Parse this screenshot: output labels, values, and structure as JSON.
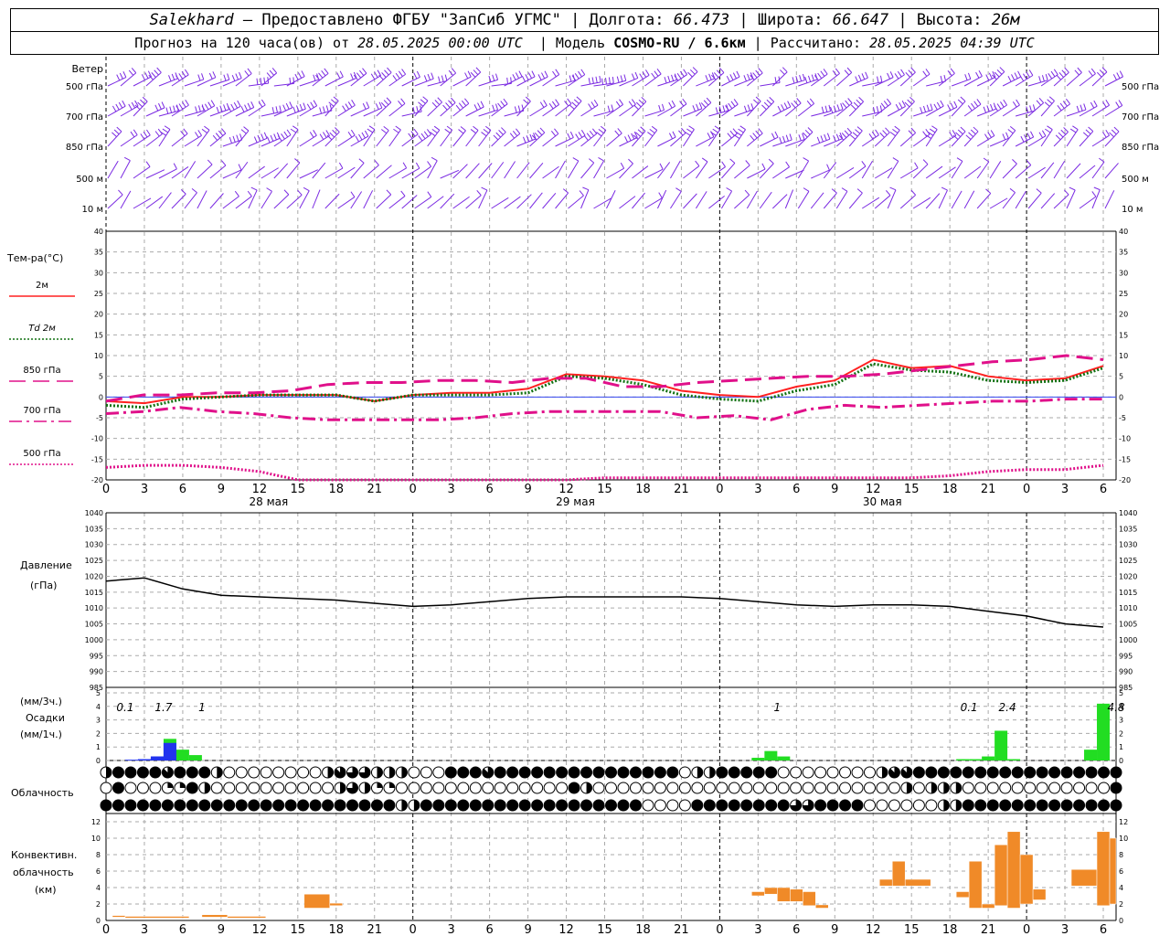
{
  "header": {
    "station": "Salekhard",
    "provided": "– Предоставлено ФГБУ \"ЗапСиб УГМС\" | Долгота:",
    "lon": "66.473",
    "lat_label": "| Широта:",
    "lat": "66.647",
    "alt_label": "| Высота:",
    "alt": "26м",
    "forecast_prefix": "Прогноз на 120 часа(ов) от",
    "forecast_start": "28.05.2025 00:00 UTC",
    "model_label": "| Модель",
    "model": "COSMO-RU / 6.6км",
    "calc_label": "| Рассчитано:",
    "calc_time": "28.05.2025 04:39 UTC"
  },
  "wind_panel": {
    "title": "Ветер",
    "levels": [
      "500 гПа",
      "700 гПа",
      "850 гПа",
      "500 м",
      "10  м"
    ],
    "color": "#7b2be2"
  },
  "chart_data": [
    {
      "type": "line",
      "name": "temperature",
      "title": "Тем-ра(°C)",
      "ylim": [
        -20,
        40
      ],
      "yticks": [
        -20,
        -15,
        -10,
        -5,
        0,
        5,
        10,
        15,
        20,
        25,
        30,
        35,
        40
      ],
      "x_hours": [
        0,
        3,
        6,
        9,
        12,
        15,
        18,
        21,
        24,
        27,
        30,
        33,
        36,
        39,
        42,
        45,
        48,
        51,
        54,
        57,
        60,
        63,
        66,
        69,
        72,
        75,
        78
      ],
      "x_tick_labels": [
        "0",
        "3",
        "6",
        "9",
        "12",
        "15",
        "18",
        "21",
        "0",
        "3",
        "6",
        "9",
        "12",
        "15",
        "18",
        "21",
        "0",
        "3",
        "6",
        "9",
        "12",
        "15",
        "18",
        "21",
        "0",
        "3",
        "6"
      ],
      "day_labels": [
        {
          "hour": 12,
          "text": "28 мая"
        },
        {
          "hour": 36,
          "text": "29 мая"
        },
        {
          "hour": 60,
          "text": "30 мая"
        }
      ],
      "series": [
        {
          "name": "2м",
          "color": "#ff2020",
          "style": "solid",
          "values": [
            -1,
            -1.5,
            0,
            0,
            0.5,
            0.5,
            0.5,
            -1,
            0.5,
            1,
            1,
            2,
            5.5,
            5,
            4,
            1.5,
            0.5,
            0,
            2.5,
            4,
            9,
            7,
            7.5,
            5,
            4,
            4.5,
            7.5
          ]
        },
        {
          "name": "Td 2м",
          "color": "#107010",
          "style": "dotted",
          "values": [
            -2,
            -2.5,
            -0.5,
            0,
            0.5,
            0.5,
            0.5,
            -1,
            0.5,
            0.5,
            0.5,
            1,
            5,
            4.5,
            3,
            0.5,
            -0.5,
            -1,
            1.5,
            3,
            8,
            6.5,
            6,
            4,
            3.5,
            4,
            7
          ]
        },
        {
          "name": "850 гПа",
          "color": "#e0108a",
          "style": "longdash",
          "values": [
            -1,
            0.5,
            0.5,
            1,
            1,
            1.5,
            3,
            3.5,
            3.5,
            4,
            4,
            3.5,
            4.5,
            4.5,
            2.5,
            2.5,
            3.5,
            4,
            4.5,
            5,
            5,
            5.5,
            6.5,
            7.5,
            8.5,
            9,
            10,
            9
          ]
        },
        {
          "name": "700 гПа",
          "color": "#e0108a",
          "style": "dashdot",
          "values": [
            -4,
            -3.5,
            -2.5,
            -3.5,
            -4,
            -5,
            -5.5,
            -5.5,
            -5.5,
            -5.5,
            -5,
            -4,
            -3.5,
            -3.5,
            -3.5,
            -3.5,
            -5,
            -4.5,
            -5.5,
            -3,
            -2,
            -2.5,
            -2,
            -1.5,
            -1,
            -1,
            -0.5,
            -0.5
          ]
        },
        {
          "name": "500 гПа",
          "color": "#e0108a",
          "style": "dotted",
          "values": [
            -17,
            -16.5,
            -16.5,
            -17,
            -18,
            -20,
            -21,
            -21,
            -21,
            -21,
            -21,
            -21,
            -20,
            -19.5,
            -19.5,
            -19.5,
            -19.5,
            -19.5,
            -19.5,
            -19.5,
            -19.5,
            -19.5,
            -19,
            -18,
            -17.5,
            -17.5,
            -16.5
          ]
        }
      ]
    },
    {
      "type": "line",
      "name": "pressure",
      "title": "Давление",
      "unit": "(гПа)",
      "ylim": [
        985,
        1040
      ],
      "yticks": [
        985,
        990,
        995,
        1000,
        1005,
        1010,
        1015,
        1020,
        1025,
        1030,
        1035,
        1040
      ],
      "series": [
        {
          "name": "pressure",
          "color": "#000000",
          "values": [
            1018.5,
            1019.5,
            1016,
            1014,
            1013.5,
            1013,
            1012.5,
            1011.5,
            1010.5,
            1011,
            1012,
            1013,
            1013.5,
            1013.5,
            1013.5,
            1013.5,
            1013,
            1012,
            1011,
            1010.5,
            1011,
            1011,
            1010.5,
            1009,
            1007.5,
            1005,
            1004
          ]
        }
      ]
    },
    {
      "type": "bar",
      "name": "precipitation",
      "title": "Осадки",
      "unit_3h": "(мм/3ч.)",
      "unit_1h": "(мм/1ч.)",
      "ylim": [
        0,
        5
      ],
      "yticks": [
        0,
        1,
        2,
        3,
        4,
        5
      ],
      "annotations": [
        {
          "hour": 1.5,
          "text": "0.1"
        },
        {
          "hour": 4.5,
          "text": "1.7"
        },
        {
          "hour": 7.5,
          "text": "1"
        },
        {
          "hour": 52.5,
          "text": "1"
        },
        {
          "hour": 67.5,
          "text": "0.1"
        },
        {
          "hour": 70.5,
          "text": "2.4"
        },
        {
          "hour": 79,
          "text": "4.8"
        }
      ],
      "bars": [
        {
          "hour": 2,
          "value": 0.05,
          "kind": "snow"
        },
        {
          "hour": 3,
          "value": 0.1,
          "kind": "snow"
        },
        {
          "hour": 4,
          "value": 0.3,
          "kind": "snow"
        },
        {
          "hour": 5,
          "value": 1.3,
          "kind": "snow"
        },
        {
          "hour": 5,
          "value": 1.6,
          "kind": "rain"
        },
        {
          "hour": 6,
          "value": 0.8,
          "kind": "rain"
        },
        {
          "hour": 7,
          "value": 0.4,
          "kind": "rain"
        },
        {
          "hour": 51,
          "value": 0.2,
          "kind": "rain"
        },
        {
          "hour": 52,
          "value": 0.7,
          "kind": "rain"
        },
        {
          "hour": 53,
          "value": 0.3,
          "kind": "rain"
        },
        {
          "hour": 67,
          "value": 0.1,
          "kind": "rain"
        },
        {
          "hour": 68,
          "value": 0.1,
          "kind": "rain"
        },
        {
          "hour": 69,
          "value": 0.3,
          "kind": "rain"
        },
        {
          "hour": 70,
          "value": 2.2,
          "kind": "rain"
        },
        {
          "hour": 71,
          "value": 0.1,
          "kind": "rain"
        },
        {
          "hour": 77,
          "value": 0.8,
          "kind": "rain"
        },
        {
          "hour": 78,
          "value": 4.2,
          "kind": "rain"
        }
      ],
      "colors": {
        "rain": "#22dd22",
        "snow": "#2233ee"
      }
    },
    {
      "type": "bar",
      "name": "convective_cloud",
      "title": "Конвективн.",
      "title2": "облачность",
      "unit": "(км)",
      "ylim": [
        0,
        13
      ],
      "yticks": [
        0,
        2,
        4,
        6,
        8,
        10,
        12
      ],
      "bars": [
        {
          "x0": 0.5,
          "x1": 1.5,
          "base": 0.4,
          "top": 0.6
        },
        {
          "x0": 1.5,
          "x1": 6.5,
          "base": 0.3,
          "top": 0.5
        },
        {
          "x0": 7.5,
          "x1": 9.5,
          "base": 0.4,
          "top": 0.7
        },
        {
          "x0": 9.5,
          "x1": 12.5,
          "base": 0.3,
          "top": 0.5
        },
        {
          "x0": 15.5,
          "x1": 17.5,
          "base": 1.5,
          "top": 3.2
        },
        {
          "x0": 17.5,
          "x1": 18.5,
          "base": 1.8,
          "top": 2.1
        },
        {
          "x0": 50.5,
          "x1": 51.5,
          "base": 3.0,
          "top": 3.5
        },
        {
          "x0": 51.5,
          "x1": 52.5,
          "base": 3.2,
          "top": 4.0
        },
        {
          "x0": 52.5,
          "x1": 53.5,
          "base": 2.3,
          "top": 4.0
        },
        {
          "x0": 53.5,
          "x1": 54.5,
          "base": 2.3,
          "top": 3.8
        },
        {
          "x0": 54.5,
          "x1": 55.5,
          "base": 1.8,
          "top": 3.5
        },
        {
          "x0": 55.5,
          "x1": 56.5,
          "base": 1.5,
          "top": 1.9
        },
        {
          "x0": 60.5,
          "x1": 61.5,
          "base": 4.2,
          "top": 5.0
        },
        {
          "x0": 61.5,
          "x1": 62.5,
          "base": 4.2,
          "top": 7.2
        },
        {
          "x0": 62.5,
          "x1": 64.5,
          "base": 4.2,
          "top": 5.0
        },
        {
          "x0": 66.5,
          "x1": 67.5,
          "base": 2.8,
          "top": 3.5
        },
        {
          "x0": 67.5,
          "x1": 68.5,
          "base": 1.5,
          "top": 7.2
        },
        {
          "x0": 68.5,
          "x1": 69.5,
          "base": 1.5,
          "top": 2.0
        },
        {
          "x0": 69.5,
          "x1": 70.5,
          "base": 1.8,
          "top": 9.2
        },
        {
          "x0": 70.5,
          "x1": 71.5,
          "base": 1.5,
          "top": 10.8
        },
        {
          "x0": 71.5,
          "x1": 72.5,
          "base": 2.0,
          "top": 8.0
        },
        {
          "x0": 72.5,
          "x1": 73.5,
          "base": 2.5,
          "top": 3.8
        },
        {
          "x0": 75.5,
          "x1": 77.5,
          "base": 4.2,
          "top": 6.2
        },
        {
          "x0": 77.5,
          "x1": 78.5,
          "base": 1.8,
          "top": 10.8
        },
        {
          "x0": 78.5,
          "x1": 79.0,
          "base": 2.0,
          "top": 10.0
        }
      ],
      "color": "#f08a28"
    }
  ],
  "cloud_panel": {
    "title": "Облачность",
    "rows": [
      [
        4,
        8,
        8,
        8,
        8,
        7,
        8,
        8,
        8,
        4,
        0,
        0,
        0,
        0,
        0,
        0,
        0,
        0,
        4,
        7,
        6,
        6,
        4,
        4,
        4,
        0,
        0,
        0,
        8,
        8,
        8,
        7,
        8,
        8,
        8,
        8,
        8,
        8,
        8,
        8,
        8,
        8,
        8,
        8,
        8,
        8,
        8,
        0,
        4,
        4,
        8,
        8,
        8,
        8,
        8,
        0,
        0,
        0,
        0,
        0,
        0,
        0,
        0,
        4,
        7,
        7,
        8,
        8,
        8,
        8,
        8,
        8,
        8,
        8,
        8,
        8,
        8,
        8,
        8,
        8,
        8,
        8,
        8
      ],
      [
        0,
        8,
        0,
        0,
        0,
        2,
        2,
        8,
        4,
        0,
        0,
        0,
        0,
        0,
        0,
        0,
        0,
        0,
        0,
        4,
        6,
        4,
        2,
        2,
        0,
        0,
        0,
        0,
        0,
        0,
        0,
        0,
        0,
        0,
        0,
        0,
        0,
        0,
        8,
        4,
        0,
        0,
        0,
        0,
        0,
        0,
        0,
        0,
        0,
        0,
        0,
        0,
        0,
        0,
        0,
        0,
        0,
        0,
        0,
        0,
        0,
        0,
        0,
        0,
        0,
        4,
        0,
        4,
        4,
        4,
        0,
        0,
        0,
        0,
        0,
        0,
        0,
        0,
        0,
        0,
        0,
        0,
        8
      ],
      [
        8,
        8,
        8,
        8,
        8,
        8,
        8,
        8,
        8,
        8,
        8,
        8,
        8,
        8,
        8,
        8,
        8,
        8,
        8,
        8,
        8,
        8,
        8,
        8,
        4,
        4,
        8,
        8,
        8,
        8,
        8,
        8,
        8,
        8,
        8,
        8,
        8,
        8,
        8,
        8,
        8,
        8,
        8,
        8,
        0,
        0,
        0,
        0,
        8,
        8,
        8,
        8,
        8,
        8,
        8,
        8,
        6,
        6,
        8,
        8,
        8,
        8,
        0,
        0,
        0,
        0,
        0,
        0,
        4,
        4,
        8,
        8,
        8,
        8,
        8,
        8,
        8,
        8,
        8,
        8,
        8,
        8,
        8
      ]
    ]
  }
}
